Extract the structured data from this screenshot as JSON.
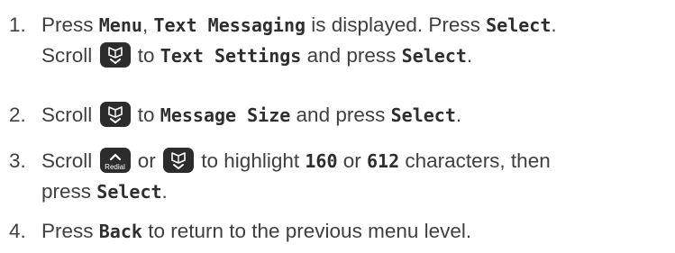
{
  "steps": [
    {
      "num": "1.",
      "line1": {
        "t1": "Press ",
        "lcd1": "Menu",
        "t2": ", ",
        "lcd2": "Text Messaging",
        "t3": " is displayed. Press ",
        "lcd3": "Select",
        "t4": "."
      },
      "line2": {
        "t1": "Scroll ",
        "t2": " to ",
        "lcd1": "Text Settings",
        "t3": " and press ",
        "lcd2": "Select",
        "t4": "."
      }
    },
    {
      "num": "2.",
      "line1": {
        "t1": "Scroll ",
        "t2": " to ",
        "lcd1": "Message Size",
        "t3": " and press ",
        "lcd2": "Select",
        "t4": "."
      }
    },
    {
      "num": "3.",
      "line1": {
        "t1": "Scroll ",
        "t2": " or ",
        "t3": " to highlight ",
        "lcd1": "160",
        "t4": " or ",
        "lcd2": "612",
        "t5": " characters, then"
      },
      "line2": {
        "t1": "press ",
        "lcd1": "Select",
        "t2": "."
      }
    },
    {
      "num": "4.",
      "line1": {
        "t1": "Press ",
        "lcd1": "Back",
        "t2": " to return to the previous menu level."
      }
    }
  ],
  "keys": {
    "redial_label": "Redial",
    "key_color": "#2c2c2c"
  }
}
